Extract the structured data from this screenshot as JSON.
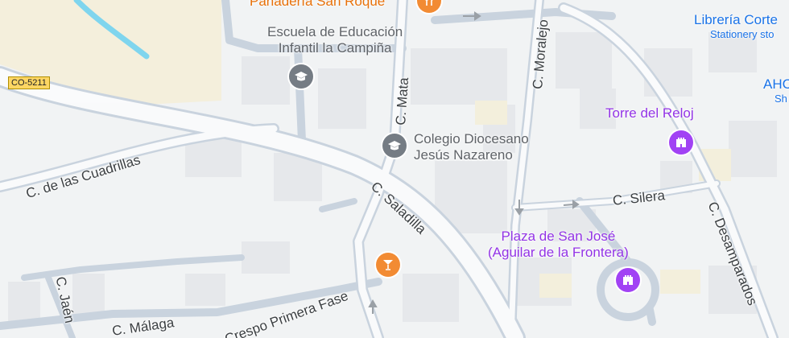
{
  "colors": {
    "background": "#f1f3f4",
    "sand": "#f4efdc",
    "road": "#c9d3de",
    "road_fill": "#ffffff",
    "water": "#7fd5ee",
    "block": "#e5e7eb",
    "school_pin": "#757c84",
    "landmark_pin": "#a142f4",
    "food_pin": "#f28b33",
    "food_text": "#e8710a",
    "landmark_text": "#9334e6",
    "shop_text": "#1a73e8",
    "school_text": "#5f6368",
    "street_text": "#3c4043"
  },
  "road_shield": "CO-5211",
  "streets": {
    "cuadrillas": "C. de las Cuadrillas",
    "mata": "C. Mata",
    "moralejo": "C. Moralejo",
    "saladilla": "C. Saladilla",
    "silera": "C. Silera",
    "desamparados": "C. Desamparados",
    "jaen": "C. Jaén",
    "malaga": "C. Málaga",
    "crespo": "ro Crespo Primera Fase"
  },
  "pois": {
    "panaderia": {
      "name": "Panadería San Roque",
      "icon": "knife-fork-icon"
    },
    "escuela": {
      "name_line1": "Escuela de Educación",
      "name_line2": "Infantil la Campiña",
      "icon": "graduation-cap-icon"
    },
    "colegio": {
      "name_line1": "Colegio Diocesano",
      "name_line2": "Jesús Nazareno",
      "icon": "graduation-cap-icon"
    },
    "libreria": {
      "name": "Librería Corte",
      "sub": "Stationery sto",
      "icon": "shop-icon"
    },
    "ahc": {
      "name": "AHC",
      "sub": "Sh"
    },
    "torre": {
      "name": "Torre del Reloj",
      "icon": "castle-icon"
    },
    "plaza": {
      "name_line1": "Plaza de San José",
      "name_line2": "(Aguilar de la Frontera)",
      "icon": "castle-icon"
    },
    "bar": {
      "icon": "cocktail-icon"
    }
  }
}
